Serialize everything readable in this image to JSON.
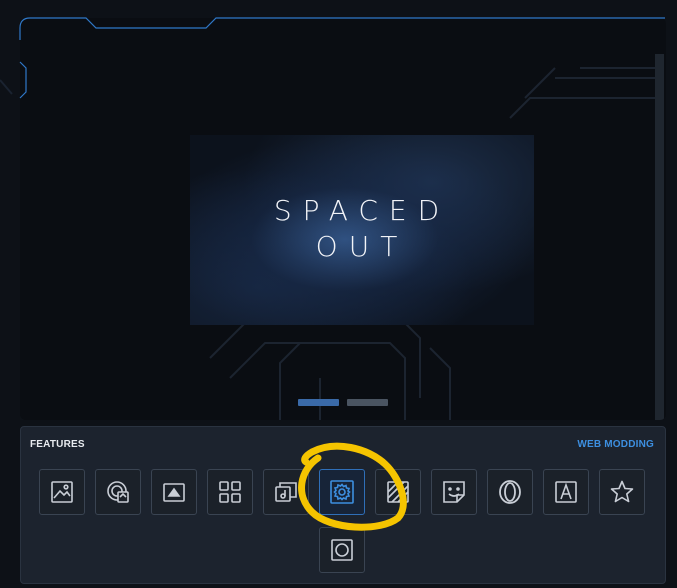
{
  "hero": {
    "title": "SPACED\nOUT"
  },
  "carousel": {
    "dots": [
      {
        "state": "active",
        "color": "#3a6aa8"
      },
      {
        "state": "inactive",
        "color": "#4a5461"
      }
    ]
  },
  "features": {
    "title": "FEATURES",
    "link_label": "WEB MODDING",
    "accent_color": "#3d8fe0",
    "items": [
      {
        "icon": "wallpaper-icon",
        "active": false
      },
      {
        "icon": "live-wallpaper-icon",
        "active": false
      },
      {
        "icon": "background-music-icon",
        "active": false
      },
      {
        "icon": "apps-grid-icon",
        "active": false
      },
      {
        "icon": "browser-sounds-icon",
        "active": false
      },
      {
        "icon": "settings-icon",
        "active": true
      },
      {
        "icon": "shader-icon",
        "active": false
      },
      {
        "icon": "sticker-icon",
        "active": false
      },
      {
        "icon": "opera-logo-icon",
        "active": false
      },
      {
        "icon": "font-icon",
        "active": false
      },
      {
        "icon": "star-icon",
        "active": false
      },
      {
        "icon": "frame-circle-icon",
        "active": false
      }
    ]
  },
  "annotation": {
    "highlight_color": "#f5c400"
  }
}
